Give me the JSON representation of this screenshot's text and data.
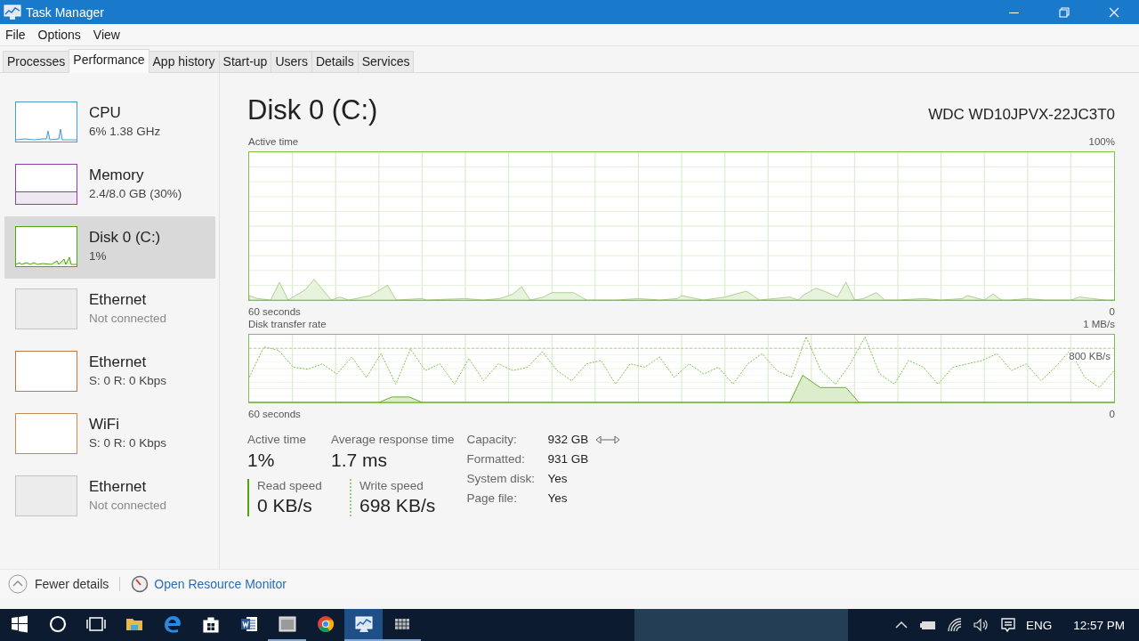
{
  "window": {
    "title": "Task Manager"
  },
  "menu": [
    "File",
    "Options",
    "View"
  ],
  "tabs": [
    {
      "label": "Processes",
      "selected": false
    },
    {
      "label": "Performance",
      "selected": true
    },
    {
      "label": "App history",
      "selected": false
    },
    {
      "label": "Start-up",
      "selected": false
    },
    {
      "label": "Users",
      "selected": false
    },
    {
      "label": "Details",
      "selected": false
    },
    {
      "label": "Services",
      "selected": false
    }
  ],
  "sidebar": {
    "items": [
      {
        "name": "CPU",
        "detail": "6%  1.38 GHz",
        "kind": "line",
        "color": "#4a9cc9",
        "selected": false
      },
      {
        "name": "Memory",
        "detail": "2.4/8.0 GB (30%)",
        "kind": "fill",
        "color": "#8b3fa8",
        "selected": false
      },
      {
        "name": "Disk 0 (C:)",
        "detail": "1%",
        "kind": "line",
        "color": "#4da60c",
        "selected": true
      },
      {
        "name": "Ethernet",
        "detail": "Not connected",
        "kind": "idle",
        "color": "#c4c4c4",
        "selected": false
      },
      {
        "name": "Ethernet",
        "detail": "S: 0 R: 0 Kbps",
        "kind": "blank",
        "color": "#c07a45",
        "selected": false
      },
      {
        "name": "WiFi",
        "detail": "S: 0 R: 0 Kbps",
        "kind": "blank",
        "color": "#c08a55",
        "selected": false
      },
      {
        "name": "Ethernet",
        "detail": "Not connected",
        "kind": "idle",
        "color": "#c4c4c4",
        "selected": false
      }
    ]
  },
  "detail": {
    "title": "Disk 0 (C:)",
    "model": "WDC WD10JPVX-22JC3T0",
    "graphs": [
      {
        "title": "Active time",
        "max_label": "100%",
        "x_label": "60 seconds",
        "min_label": "0"
      },
      {
        "title": "Disk transfer rate",
        "max_label": "1 MB/s",
        "x_label": "60 seconds",
        "min_label": "0",
        "marker_label": "800 KB/s"
      }
    ],
    "stats": [
      {
        "label": "Active time",
        "value": "1%"
      },
      {
        "label": "Average response time",
        "value": "1.7 ms"
      }
    ],
    "speeds": [
      {
        "label": "Read speed",
        "value": "0 KB/s",
        "kind": "solid"
      },
      {
        "label": "Write speed",
        "value": "698 KB/s",
        "kind": "dotted"
      }
    ],
    "properties": [
      {
        "label": "Capacity:",
        "value": "932 GB"
      },
      {
        "label": "Formatted:",
        "value": "931 GB"
      },
      {
        "label": "System disk:",
        "value": "Yes"
      },
      {
        "label": "Page file:",
        "value": "Yes"
      }
    ]
  },
  "footer": {
    "fewer_details": "Fewer details",
    "link": "Open Resource Monitor"
  },
  "taskbar": {
    "apps": [
      {
        "kind": "start",
        "running": false,
        "selected": false
      },
      {
        "kind": "search",
        "running": false,
        "selected": false
      },
      {
        "kind": "taskview",
        "running": false,
        "selected": false
      },
      {
        "kind": "folder",
        "running": false,
        "selected": false
      },
      {
        "kind": "browser",
        "running": false,
        "selected": false
      },
      {
        "kind": "store",
        "running": false,
        "selected": false
      },
      {
        "kind": "document",
        "running": false,
        "selected": false
      },
      {
        "kind": "window",
        "running": true,
        "selected": false
      },
      {
        "kind": "chrome",
        "running": false,
        "selected": false
      },
      {
        "kind": "monitor",
        "running": true,
        "selected": true
      },
      {
        "kind": "grid",
        "running": true,
        "selected": false
      }
    ],
    "language": "ENG",
    "time": "12:57 PM"
  }
}
